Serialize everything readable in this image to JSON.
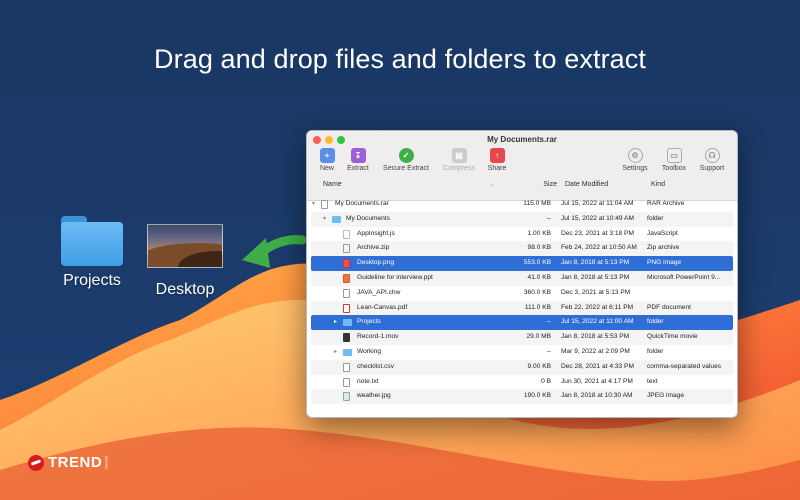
{
  "headline": "Drag and drop files and folders to extract",
  "desktop": {
    "items": [
      {
        "label": "Projects",
        "icon": "folder-icon"
      },
      {
        "label": "Desktop",
        "icon": "image-thumbnail"
      }
    ]
  },
  "window": {
    "title": "My Documents.rar",
    "toolbar": [
      {
        "label": "New",
        "icon": "new-icon",
        "color": "#5a8ee8",
        "enabled": true
      },
      {
        "label": "Extract",
        "icon": "extract-icon",
        "color": "#9b5fd6",
        "enabled": true
      },
      {
        "label": "Secure Extract",
        "icon": "shield-icon",
        "color": "#3fae49",
        "enabled": true
      },
      {
        "label": "Compress",
        "icon": "compress-icon",
        "color": "#aaaaaa",
        "enabled": false
      },
      {
        "label": "Share",
        "icon": "share-icon",
        "color": "#e5484d",
        "enabled": true
      },
      {
        "label": "Settings",
        "icon": "gear-icon",
        "color": "#999999",
        "enabled": true
      },
      {
        "label": "Toolbox",
        "icon": "toolbox-icon",
        "color": "#999999",
        "enabled": true
      },
      {
        "label": "Support",
        "icon": "support-icon",
        "color": "#999999",
        "enabled": true
      }
    ],
    "columns": {
      "name": "Name",
      "size": "Size",
      "date": "Date Modified",
      "kind": "Kind"
    },
    "rows": [
      {
        "level": 0,
        "disclosure": "open",
        "icon": "rar",
        "name": "My Documents.rar",
        "size": "115.0 MB",
        "date": "Jul 15, 2022 at 11:04 AM",
        "kind": "RAR Archive",
        "selected": false
      },
      {
        "level": 1,
        "disclosure": "open",
        "icon": "folder",
        "name": "My Documents",
        "size": "--",
        "date": "Jul 15, 2022 at 10:49 AM",
        "kind": "folder",
        "selected": false
      },
      {
        "level": 2,
        "disclosure": "",
        "icon": "js",
        "name": "AppInsight.js",
        "size": "1.00 KB",
        "date": "Dec 23, 2021 at 3:18 PM",
        "kind": "JavaScript",
        "selected": false
      },
      {
        "level": 2,
        "disclosure": "",
        "icon": "zip",
        "name": "Archive.zip",
        "size": "98.0 KB",
        "date": "Feb 24, 2022 at 10:50 AM",
        "kind": "Zip archive",
        "selected": false
      },
      {
        "level": 2,
        "disclosure": "",
        "icon": "png",
        "name": "Desktop.png",
        "size": "553.0 KB",
        "date": "Jan 8, 2018 at 5:13 PM",
        "kind": "PNG image",
        "selected": true
      },
      {
        "level": 2,
        "disclosure": "",
        "icon": "ppt",
        "name": "Guideline for interview.ppt",
        "size": "41.0 KB",
        "date": "Jan 8, 2018 at 5:13 PM",
        "kind": "Microsoft PowerPoint 9...",
        "selected": false
      },
      {
        "level": 2,
        "disclosure": "",
        "icon": "doc",
        "name": "JAVA_API.chw",
        "size": "360.0 KB",
        "date": "Dec 3, 2021 at 5:13 PM",
        "kind": "",
        "selected": false
      },
      {
        "level": 2,
        "disclosure": "",
        "icon": "pdf",
        "name": "Lean-Canvas.pdf",
        "size": "111.0 KB",
        "date": "Feb 22, 2022 at 6:11 PM",
        "kind": "PDF document",
        "selected": false
      },
      {
        "level": 2,
        "disclosure": "closed",
        "icon": "folder",
        "name": "Projects",
        "size": "--",
        "date": "Jul 15, 2022 at 11:00 AM",
        "kind": "folder",
        "selected": true
      },
      {
        "level": 2,
        "disclosure": "",
        "icon": "mov",
        "name": "Record-1.mov",
        "size": "29.0 MB",
        "date": "Jan 8, 2018 at 5:53 PM",
        "kind": "QuickTime movie",
        "selected": false
      },
      {
        "level": 2,
        "disclosure": "closed",
        "icon": "folder",
        "name": "Working",
        "size": "--",
        "date": "Mar 9, 2022 at 2:09 PM",
        "kind": "folder",
        "selected": false
      },
      {
        "level": 2,
        "disclosure": "",
        "icon": "doc",
        "name": "checklist.csv",
        "size": "9.00 KB",
        "date": "Dec 28, 2021 at 4:33 PM",
        "kind": "comma-separated values",
        "selected": false
      },
      {
        "level": 2,
        "disclosure": "",
        "icon": "doc",
        "name": "note.txt",
        "size": "0 B",
        "date": "Jun 30, 2021 at 4:17 PM",
        "kind": "text",
        "selected": false
      },
      {
        "level": 2,
        "disclosure": "",
        "icon": "jpg",
        "name": "weather.jpg",
        "size": "190.0 KB",
        "date": "Jan 8, 2018 at 10:30 AM",
        "kind": "JPEG image",
        "selected": false
      }
    ]
  },
  "brand": {
    "logo": "TREND",
    "micro": "MICRO"
  },
  "colors": {
    "selection": "#2f6ed6",
    "arrow": "#3fae49"
  }
}
